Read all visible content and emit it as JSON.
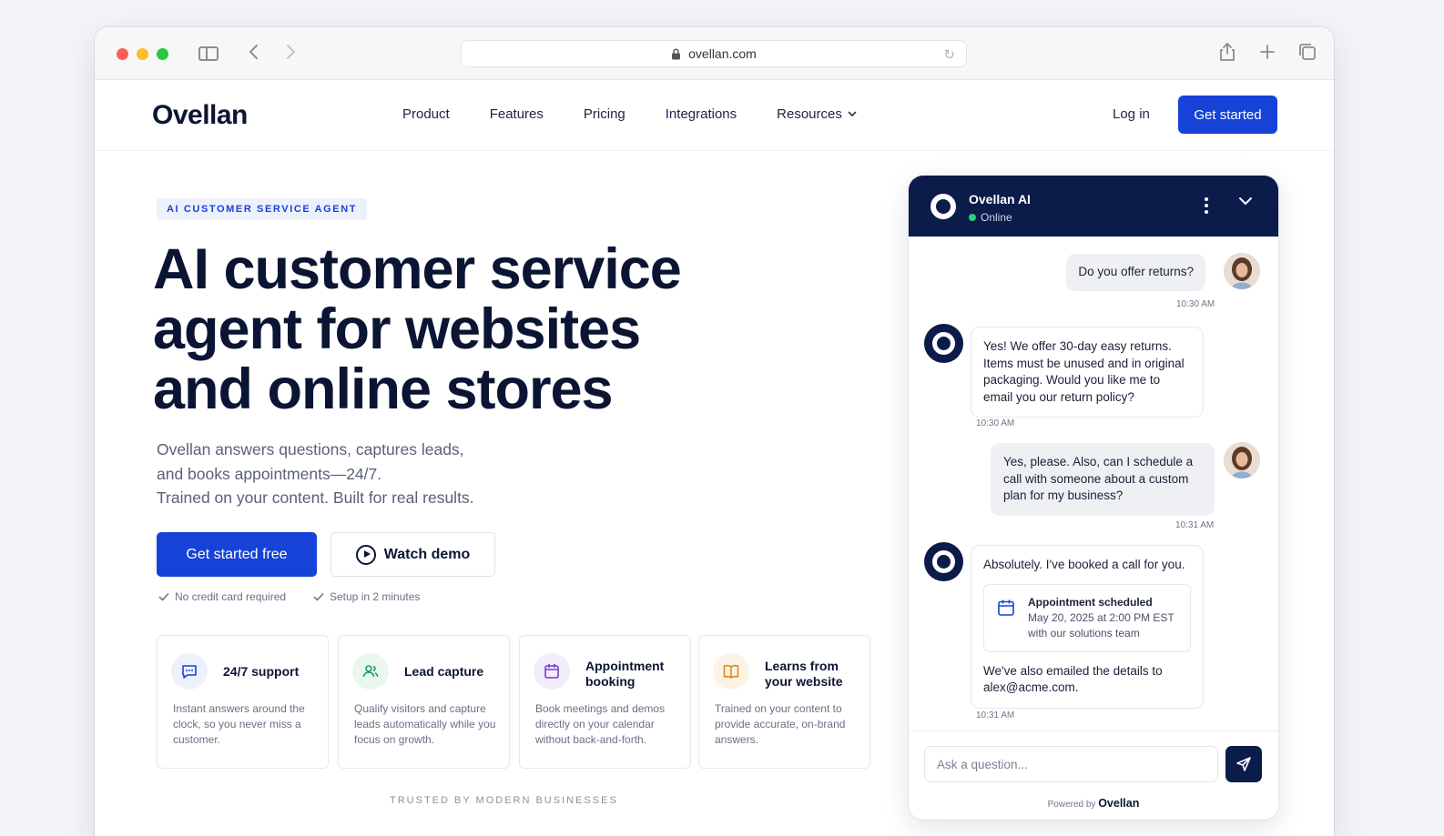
{
  "browser": {
    "url": "ovellan.com"
  },
  "site": {
    "logo": "Ovellan",
    "nav": [
      "Product",
      "Features",
      "Pricing",
      "Integrations",
      "Resources"
    ],
    "login": "Log in",
    "get_started": "Get started"
  },
  "hero": {
    "badge": "AI CUSTOMER SERVICE AGENT",
    "headline_lines": [
      "AI customer service",
      "agent for websites",
      "and online stores"
    ],
    "subtext_lines": [
      "Ovellan answers questions, captures leads,",
      "and books appointments—24/7.",
      "Trained on your content. Built for real results."
    ],
    "cta_primary": "Get started free",
    "cta_secondary": "Watch demo",
    "reassurances": [
      "No credit card required",
      "Setup in 2 minutes"
    ]
  },
  "features": [
    {
      "title": "24/7 support",
      "desc": "Instant answers around the clock, so you never miss a customer.",
      "icon": "chat-icon",
      "color": "#1742d8",
      "bg": "#edf1fc"
    },
    {
      "title": "Lead capture",
      "desc": "Qualify visitors and capture leads automatically while you focus on growth.",
      "icon": "users-icon",
      "color": "#1f9d5f",
      "bg": "#e9f7ef"
    },
    {
      "title": "Appointment booking",
      "desc": "Book meetings and demos directly on your calendar without back-and-forth.",
      "icon": "calendar-icon",
      "color": "#7a3fc4",
      "bg": "#f2ecfb"
    },
    {
      "title": "Learns from your website",
      "desc": "Trained on your content to provide accurate, on-brand answers.",
      "icon": "book-icon",
      "color": "#d98a1c",
      "bg": "#fdf3e4"
    }
  ],
  "trusted": "TRUSTED BY MODERN BUSINESSES",
  "chat": {
    "name": "Ovellan AI",
    "status": "Online",
    "messages": [
      {
        "from": "user",
        "text": "Do you offer returns?",
        "time": "10:30 AM"
      },
      {
        "from": "bot",
        "text": "Yes! We offer 30-day easy returns. Items must be unused and in original packaging. Would you like me to email you our return policy?",
        "time": "10:30 AM"
      },
      {
        "from": "user",
        "text": "Yes, please. Also, can I schedule a call with someone about a custom plan for my business?",
        "time": "10:31 AM"
      },
      {
        "from": "bot",
        "text": "Absolutely. I've booked a call for you.",
        "time": "10:31 AM"
      }
    ],
    "appointment": {
      "title": "Appointment scheduled",
      "when": "May 20, 2025 at 2:00 PM EST",
      "with": "with our solutions team"
    },
    "followup": "We've also emailed the details to alex@acme.com.",
    "input_placeholder": "Ask a question...",
    "powered_by": "Powered by",
    "powered_brand": "Ovellan"
  }
}
